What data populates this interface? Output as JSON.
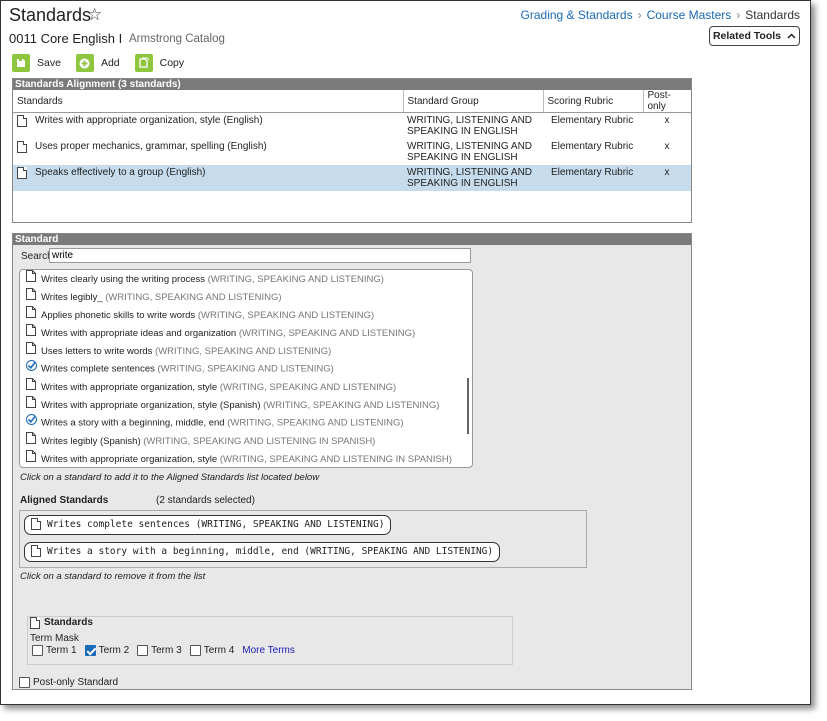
{
  "header": {
    "title": "Standards",
    "breadcrumb": [
      "Grading & Standards",
      "Course Masters",
      "Standards"
    ],
    "course": "0011 Core English I",
    "catalog": "Armstrong Catalog",
    "related_tools": "Related Tools"
  },
  "toolbar": {
    "save": "Save",
    "add": "Add",
    "copy": "Copy"
  },
  "alignment": {
    "title": "Standards Alignment (3 standards)",
    "columns": [
      "Standards",
      "Standard Group",
      "Scoring Rubric",
      "Post-only"
    ],
    "rows": [
      {
        "standard": "Writes with appropriate organization, style (English)",
        "group_l1": "WRITING, LISTENING AND",
        "group_l2": "SPEAKING IN ENGLISH",
        "rubric": "Elementary Rubric",
        "post": "x"
      },
      {
        "standard": "Uses proper mechanics, grammar, spelling (English)",
        "group_l1": "WRITING, LISTENING AND",
        "group_l2": "SPEAKING IN ENGLISH",
        "rubric": "Elementary Rubric",
        "post": "x"
      },
      {
        "standard": "Speaks effectively to a group (English)",
        "group_l1": "WRITING, LISTENING AND",
        "group_l2": "SPEAKING IN ENGLISH",
        "rubric": "Elementary Rubric",
        "post": "x"
      }
    ]
  },
  "standard": {
    "title": "Standard",
    "search_label": "Search",
    "search_value": "write",
    "list": [
      {
        "name": "Writes clearly using the writing process",
        "group": "(WRITING, SPEAKING AND LISTENING)",
        "checked": false
      },
      {
        "name": "Writes legibly_",
        "group": "(WRITING, SPEAKING AND LISTENING)",
        "checked": false
      },
      {
        "name": "Applies phonetic skills to write words",
        "group": "(WRITING, SPEAKING AND LISTENING)",
        "checked": false
      },
      {
        "name": "Writes with appropriate ideas and organization",
        "group": "(WRITING, SPEAKING AND LISTENING)",
        "checked": false
      },
      {
        "name": "Uses letters to write words",
        "group": "(WRITING, SPEAKING AND LISTENING)",
        "checked": false
      },
      {
        "name": "Writes complete sentences",
        "group": "(WRITING, SPEAKING AND LISTENING)",
        "checked": true
      },
      {
        "name": "Writes with appropriate organization, style",
        "group": "(WRITING, SPEAKING AND LISTENING)",
        "checked": false
      },
      {
        "name": "Writes with appropriate organization, style (Spanish)",
        "group": "(WRITING, SPEAKING AND LISTENING)",
        "checked": false
      },
      {
        "name": "Writes a story with a beginning, middle, end",
        "group": "(WRITING, SPEAKING AND LISTENING)",
        "checked": true
      },
      {
        "name": "Writes legibly (Spanish)",
        "group": "(WRITING, SPEAKING AND LISTENING IN SPANISH)",
        "checked": false
      },
      {
        "name": "Writes with appropriate organization, style",
        "group": "(WRITING, SPEAKING AND LISTENING IN SPANISH)",
        "checked": false
      }
    ],
    "list_hint": "Click on a standard to add it to the Aligned Standards list located below",
    "aligned_label": "Aligned Standards",
    "aligned_count": "(2 standards selected)",
    "aligned": [
      "Writes complete sentences (WRITING, SPEAKING AND LISTENING)",
      "Writes a story with a beginning, middle, end (WRITING, SPEAKING AND LISTENING)"
    ],
    "aligned_hint": "Click on a standard to remove it from the list",
    "terms_title": "Standards",
    "term_mask_label": "Term Mask",
    "terms": [
      {
        "label": "Term 1",
        "checked": false
      },
      {
        "label": "Term 2",
        "checked": true
      },
      {
        "label": "Term 3",
        "checked": false
      },
      {
        "label": "Term 4",
        "checked": false
      }
    ],
    "more_terms": "More Terms",
    "post_only_label": "Post-only Standard"
  },
  "colors": {
    "accent": "#1a6ab5",
    "button_green": "#8ec63f",
    "selected_row": "#c6dcec",
    "panel_header": "#7a7a7a"
  }
}
